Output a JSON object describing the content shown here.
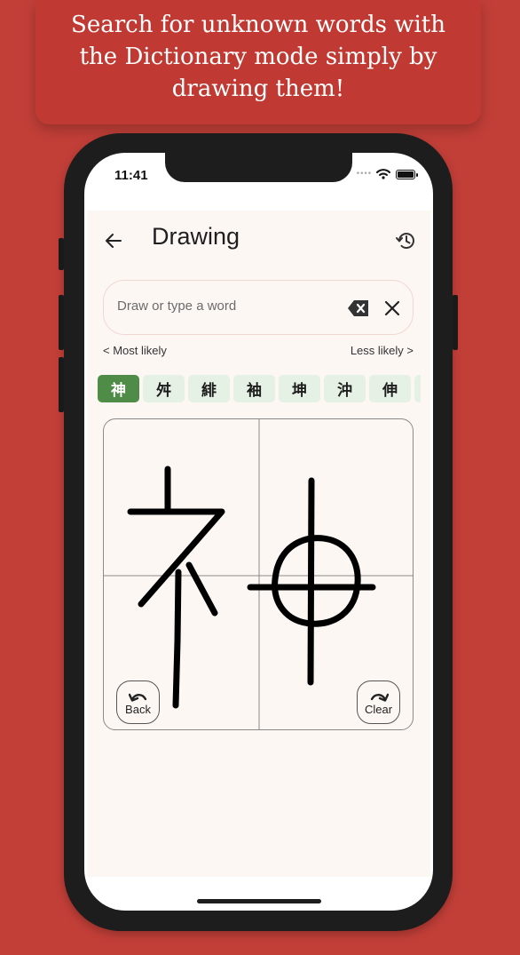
{
  "banner": {
    "text": "Search for unknown words with the Dictionary mode simply by drawing them!"
  },
  "status_bar": {
    "time": "11:41"
  },
  "header": {
    "title": "Drawing",
    "back_icon": "arrow-back-icon",
    "history_icon": "history-icon"
  },
  "search": {
    "placeholder": "Draw or type a word",
    "backspace_icon": "backspace-icon",
    "clear_icon": "close-icon"
  },
  "likely": {
    "most_label": "< Most likely",
    "less_label": "Less likely >"
  },
  "candidates": [
    "神",
    "舛",
    "緋",
    "袖",
    "坤",
    "沖",
    "伸"
  ],
  "canvas": {
    "back_label": "Back",
    "clear_label": "Clear",
    "back_icon": "undo-icon",
    "clear_icon": "redo-icon"
  },
  "colors": {
    "background": "#c23f38",
    "selected_candidate": "#4f8c48",
    "candidate": "#e5f1e4",
    "app_bg": "#fdf7f4"
  }
}
